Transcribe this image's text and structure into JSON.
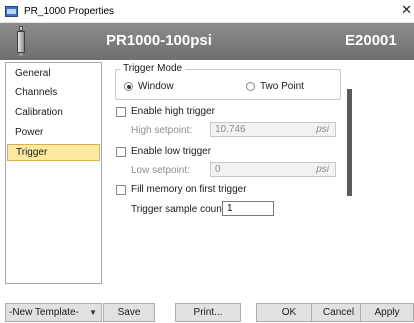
{
  "window": {
    "title": "PR_1000 Properties",
    "close_glyph": "✕"
  },
  "banner": {
    "model": "PR1000-100psi",
    "serial": "E20001",
    "device_icon": "pressure-sensor-icon"
  },
  "sidebar": {
    "items": [
      {
        "label": "General",
        "active": false
      },
      {
        "label": "Channels",
        "active": false
      },
      {
        "label": "Calibration",
        "active": false
      },
      {
        "label": "Power",
        "active": false
      },
      {
        "label": "Trigger",
        "active": true
      }
    ]
  },
  "trigger": {
    "mode_title": "Trigger Mode",
    "mode_options": [
      {
        "label": "Window",
        "selected": true
      },
      {
        "label": "Two Point",
        "selected": false
      }
    ],
    "high": {
      "checkbox_label": "Enable high trigger",
      "checked": false,
      "setpoint_label": "High setpoint:",
      "setpoint_value": "10.746",
      "unit": "psi"
    },
    "low": {
      "checkbox_label": "Enable low trigger",
      "checked": false,
      "setpoint_label": "Low setpoint:",
      "setpoint_value": "0",
      "unit": "psi"
    },
    "fill_memory": {
      "checkbox_label": "Fill memory on first trigger",
      "checked": false
    },
    "sample_count": {
      "label": "Trigger sample count:",
      "value": "1"
    }
  },
  "footer": {
    "template_value": "-New Template-",
    "save": "Save",
    "print": "Print...",
    "ok": "OK",
    "cancel": "Cancel",
    "apply": "Apply"
  }
}
